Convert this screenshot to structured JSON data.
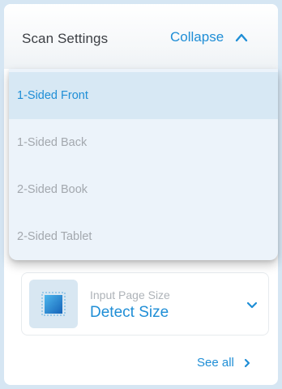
{
  "header": {
    "title": "Scan Settings",
    "collapse_label": "Collapse"
  },
  "dropdown": {
    "options": [
      {
        "label": "1-Sided Front",
        "selected": true
      },
      {
        "label": "1-Sided Back",
        "selected": false
      },
      {
        "label": "2-Sided Book",
        "selected": false
      },
      {
        "label": "2-Sided Tablet",
        "selected": false
      }
    ]
  },
  "page_size": {
    "label": "Input Page Size",
    "value": "Detect Size"
  },
  "footer": {
    "see_all_label": "See all"
  },
  "colors": {
    "accent": "#1f8ed6",
    "muted_text": "#a3a8ae",
    "selected_bg": "#d7e8f4",
    "dropdown_bg": "#ecf3fa",
    "page_bg": "#d6e6f3"
  },
  "icons": {
    "collapse": "chevron-up-icon",
    "page_size": "page-size-icon",
    "expand": "chevron-down-icon",
    "see_all": "chevron-right-icon"
  }
}
